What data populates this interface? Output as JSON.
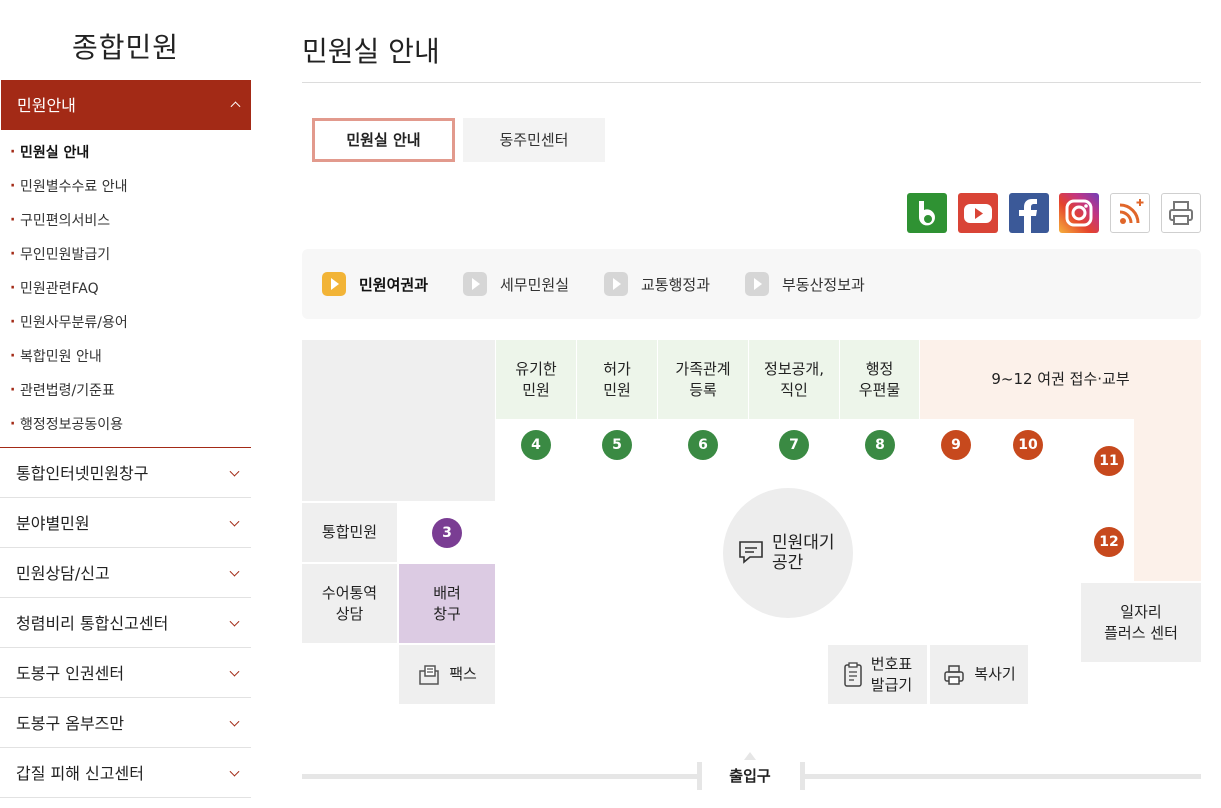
{
  "sidebar": {
    "title": "종합민원",
    "open_section": "민원안내",
    "sub_items": [
      "민원실 안내",
      "민원별수수료 안내",
      "구민편의서비스",
      "무인민원발급기",
      "민원관련FAQ",
      "민원사무분류/용어",
      "복합민원 안내",
      "관련법령/기준표",
      "행정정보공동이용"
    ],
    "sections": [
      "통합인터넷민원창구",
      "분야별민원",
      "민원상담/신고",
      "청렴비리 통합신고센터",
      "도봉구 인권센터",
      "도봉구 옴부즈만",
      "갑질 피해 신고센터"
    ]
  },
  "main": {
    "title": "민원실 안내",
    "tabs": [
      "민원실 안내",
      "동주민센터"
    ],
    "social": [
      "blog-icon",
      "youtube-icon",
      "facebook-icon",
      "instagram-icon",
      "rss-icon",
      "print-icon"
    ],
    "subtabs": [
      "민원여권과",
      "세무민원실",
      "교통행정과",
      "부동산정보과"
    ]
  },
  "floor": {
    "counters": {
      "c4": "유기한\n민원",
      "c5": "허가\n민원",
      "c6": "가족관계\n등록",
      "c7": "정보공개,\n직인",
      "c8": "행정\n우편물",
      "passport": "9~12 여권 접수·교부"
    },
    "numbers": [
      "4",
      "5",
      "6",
      "7",
      "8",
      "9",
      "10",
      "11",
      "12",
      "3"
    ],
    "integrated": "통합민원",
    "sign": "수어통역\n상담",
    "care": "배려\n창구",
    "fax": "팩스",
    "waiting": "민원대기\n공간",
    "ticket": "번호표\n발급기",
    "copier": "복사기",
    "jobs": "일자리\n플러스 센터",
    "entrance": "출입구"
  },
  "colors": {
    "accent": "#a32a16",
    "green_num": "#3a8a43",
    "orange_num": "#c7491d",
    "purple_num": "#7a3d93"
  }
}
